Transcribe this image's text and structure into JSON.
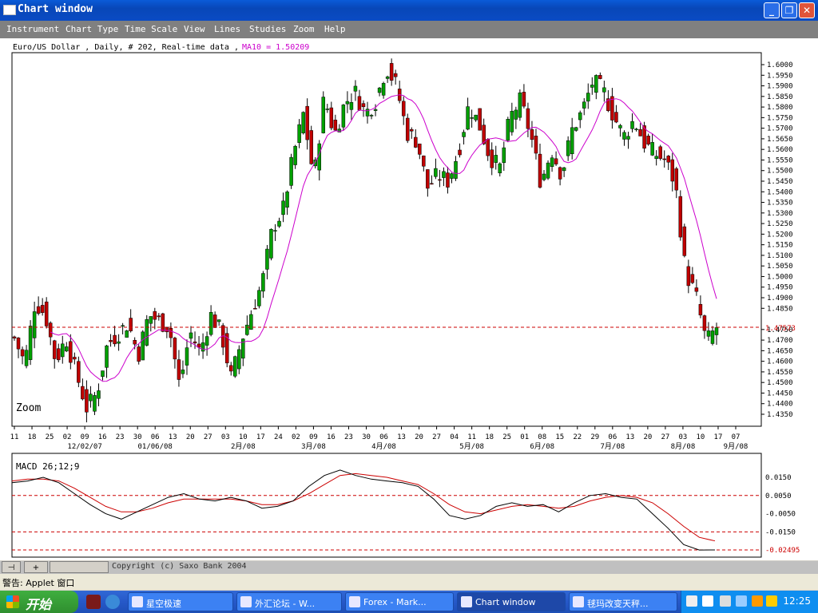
{
  "window": {
    "title": "Chart window"
  },
  "menu": [
    "Instrument",
    "Chart Type",
    "Time Scale",
    "View",
    "Lines",
    "Studies",
    "Zoom",
    "Help"
  ],
  "chart_header": {
    "instrument_info": "Euro/US Dollar , Daily, # 202, Real-time data ,",
    "ma_label": "MA10 = 1.50209"
  },
  "zoom_label": "Zoom",
  "macd_label": "MACD 26;12;9",
  "copyright": "Copyright (c) Saxo Bank 2004",
  "status_warning": "警告: Applet 窗口",
  "start_label": "开始",
  "taskbar_items": [
    "星空极速",
    "外汇论坛 - W...",
    "Forex - Mark...",
    "Chart window",
    "毬玛改变天秤..."
  ],
  "clock": "12:25",
  "colors": {
    "up_candle": "#00a000",
    "down_candle": "#c00000",
    "ma_line": "#cc00cc",
    "macd_line": "#000000",
    "signal_line": "#cc0000",
    "level_line": "#cc0000",
    "title_bar": "#0a5bd8",
    "menu_bar": "#808080"
  },
  "chart_data": [
    {
      "type": "candlestick",
      "title": "Euro/US Dollar , Daily, # 202, Real-time data",
      "current_level": "1.47573",
      "ylim": [
        1.43,
        1.605
      ],
      "y_ticks": [
        "1.6000",
        "1.5950",
        "1.5900",
        "1.5850",
        "1.5800",
        "1.5750",
        "1.5700",
        "1.5650",
        "1.5600",
        "1.5550",
        "1.5500",
        "1.5450",
        "1.5400",
        "1.5350",
        "1.5300",
        "1.5250",
        "1.5200",
        "1.5150",
        "1.5100",
        "1.5050",
        "1.5000",
        "1.4950",
        "1.4900",
        "1.4850",
        "1.4750",
        "1.4700",
        "1.4650",
        "1.4600",
        "1.4550",
        "1.4500",
        "1.4450",
        "1.4400",
        "1.4350"
      ],
      "x_day_ticks": [
        "11",
        "18",
        "25",
        "02",
        "09",
        "16",
        "23",
        "30",
        "06",
        "13",
        "20",
        "27",
        "03",
        "10",
        "17",
        "24",
        "02",
        "09",
        "16",
        "23",
        "30",
        "06",
        "13",
        "20",
        "27",
        "04",
        "11",
        "18",
        "25",
        "01",
        "08",
        "15",
        "22",
        "29",
        "06",
        "13",
        "20",
        "27",
        "03",
        "10",
        "17",
        "07"
      ],
      "x_month_ticks": [
        "12/02/07",
        "01/06/08",
        "2月/08",
        "3月/08",
        "4月/08",
        "5月/08",
        "6月/08",
        "7月/08",
        "8月/08",
        "9月/08"
      ],
      "close_path": [
        1.471,
        1.459,
        1.488,
        1.482,
        1.46,
        1.471,
        1.454,
        1.438,
        1.445,
        1.468,
        1.473,
        1.478,
        1.463,
        1.482,
        1.479,
        1.476,
        1.448,
        1.474,
        1.464,
        1.482,
        1.474,
        1.452,
        1.47,
        1.484,
        1.497,
        1.523,
        1.531,
        1.557,
        1.577,
        1.546,
        1.585,
        1.567,
        1.582,
        1.587,
        1.577,
        1.583,
        1.599,
        1.59,
        1.568,
        1.564,
        1.542,
        1.548,
        1.545,
        1.559,
        1.581,
        1.572,
        1.557,
        1.551,
        1.575,
        1.583,
        1.567,
        1.544,
        1.56,
        1.548,
        1.569,
        1.578,
        1.592,
        1.588,
        1.576,
        1.566,
        1.574,
        1.563,
        1.558,
        1.555,
        1.544,
        1.502,
        1.491,
        1.469,
        1.476
      ],
      "ma10_end": 1.50209
    },
    {
      "type": "line",
      "title": "MACD 26;12;9",
      "y_ticks": [
        "0.0150",
        "0.0050",
        "-0.0050",
        "-0.0150",
        "-0.02495"
      ],
      "ylim": [
        -0.0265,
        0.0195
      ],
      "macd": [
        0.012,
        0.013,
        0.015,
        0.012,
        0.006,
        0.0,
        -0.005,
        -0.008,
        -0.004,
        0.0,
        0.004,
        0.006,
        0.003,
        0.002,
        0.004,
        0.002,
        -0.002,
        -0.001,
        0.002,
        0.01,
        0.016,
        0.019,
        0.016,
        0.014,
        0.013,
        0.012,
        0.01,
        0.003,
        -0.006,
        -0.008,
        -0.006,
        -0.001,
        0.001,
        -0.001,
        0.0,
        -0.004,
        0.001,
        0.005,
        0.006,
        0.004,
        0.003,
        -0.005,
        -0.013,
        -0.022,
        -0.025,
        -0.02495
      ],
      "signal": [
        0.013,
        0.014,
        0.014,
        0.013,
        0.009,
        0.004,
        -0.001,
        -0.004,
        -0.004,
        -0.002,
        0.001,
        0.003,
        0.003,
        0.003,
        0.003,
        0.002,
        0.0,
        0.0,
        0.002,
        0.006,
        0.011,
        0.016,
        0.017,
        0.016,
        0.015,
        0.013,
        0.011,
        0.006,
        0.0,
        -0.004,
        -0.005,
        -0.003,
        -0.001,
        0.0,
        -0.001,
        -0.002,
        -0.001,
        0.002,
        0.004,
        0.005,
        0.004,
        0.001,
        -0.005,
        -0.012,
        -0.018,
        -0.02
      ]
    }
  ]
}
